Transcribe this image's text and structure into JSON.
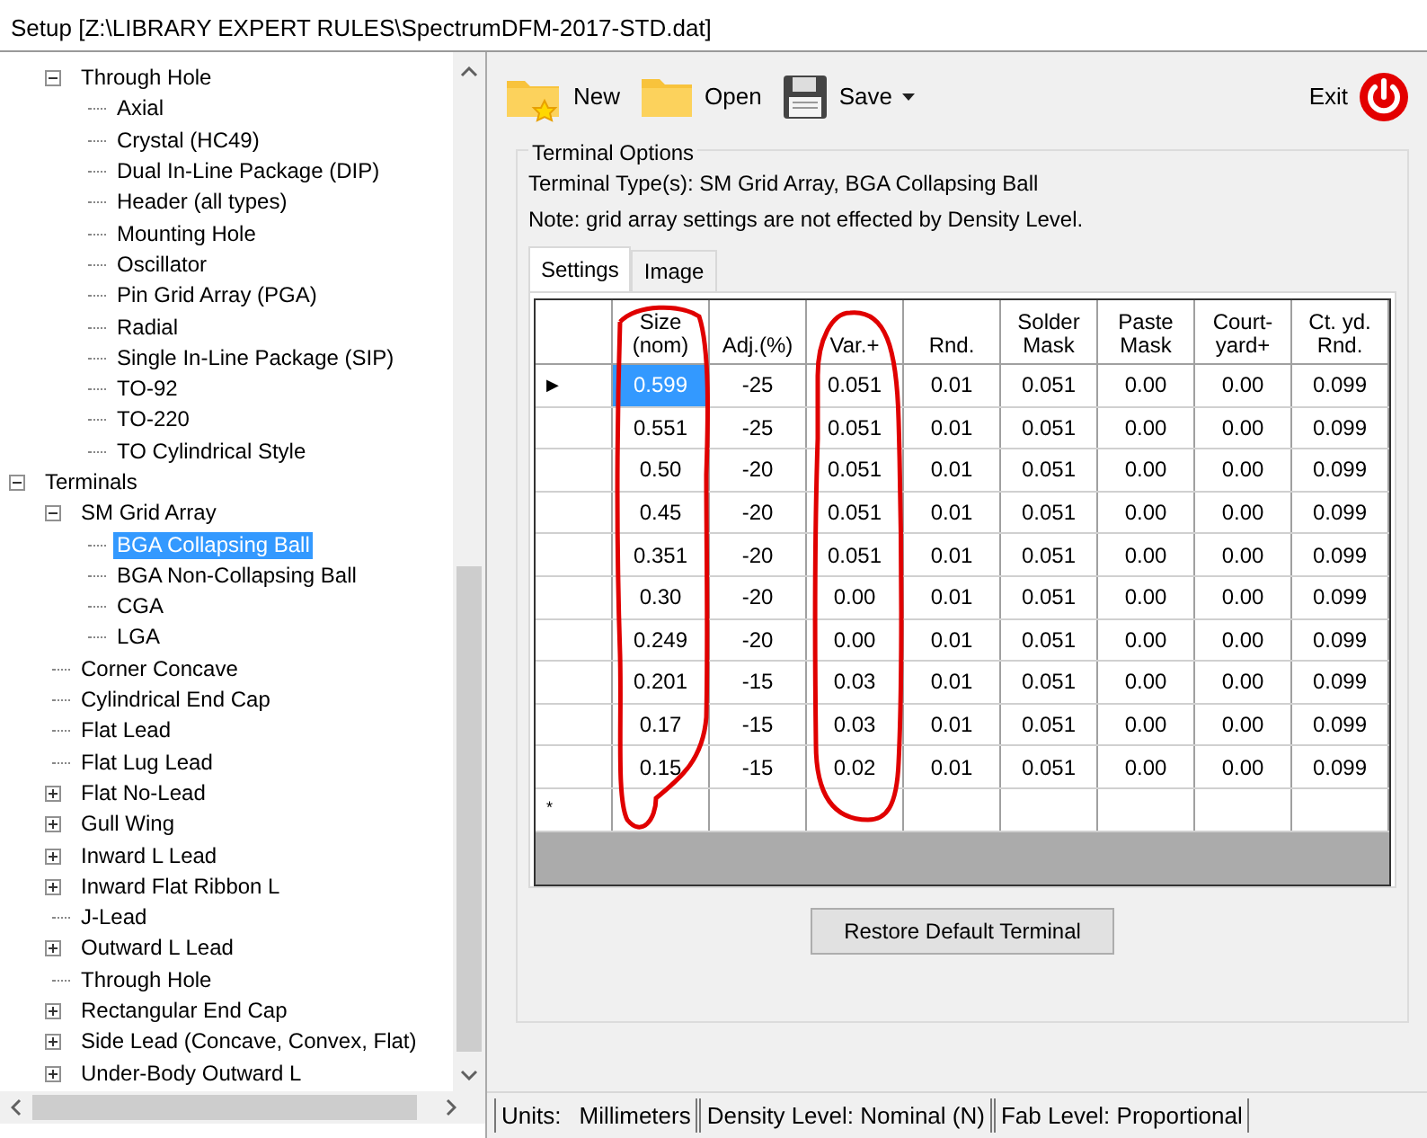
{
  "window": {
    "title": "Setup [Z:\\LIBRARY EXPERT RULES\\SpectrumDFM-2017-STD.dat]"
  },
  "tree": {
    "cut_off_branch": [
      {
        "label": "Through Hole",
        "expanded": true,
        "selected": false,
        "children": [
          {
            "label": "Axial",
            "selected": false
          },
          {
            "label": "Crystal (HC49)",
            "selected": false
          },
          {
            "label": "Dual In-Line Package (DIP)",
            "selected": false
          },
          {
            "label": "Header (all types)",
            "selected": false
          },
          {
            "label": "Mounting Hole",
            "selected": false
          },
          {
            "label": "Oscillator",
            "selected": false
          },
          {
            "label": "Pin Grid Array (PGA)",
            "selected": false
          },
          {
            "label": "Radial",
            "selected": false
          },
          {
            "label": "Single In-Line Package (SIP)",
            "selected": false
          },
          {
            "label": "TO-92",
            "selected": false
          },
          {
            "label": "TO-220",
            "selected": false
          },
          {
            "label": "TO Cylindrical Style",
            "selected": false
          }
        ]
      }
    ],
    "roots": [
      {
        "label": "Terminals",
        "expanded": true,
        "selected": false,
        "children": [
          {
            "label": "SM Grid Array",
            "expanded": true,
            "selected": false,
            "children": [
              {
                "label": "BGA Collapsing Ball",
                "selected": true
              },
              {
                "label": "BGA Non-Collapsing Ball",
                "selected": false
              },
              {
                "label": "CGA",
                "selected": false
              },
              {
                "label": "LGA",
                "selected": false
              }
            ]
          },
          {
            "label": "Corner Concave",
            "selected": false
          },
          {
            "label": "Cylindrical End Cap",
            "selected": false
          },
          {
            "label": "Flat Lead",
            "selected": false
          },
          {
            "label": "Flat Lug Lead",
            "selected": false
          },
          {
            "label": "Flat No-Lead",
            "expanded": false,
            "selected": false
          },
          {
            "label": "Gull Wing",
            "expanded": false,
            "selected": false
          },
          {
            "label": "Inward L Lead",
            "expanded": false,
            "selected": false
          },
          {
            "label": "Inward Flat Ribbon L",
            "expanded": false,
            "selected": false
          },
          {
            "label": "J-Lead",
            "selected": false
          },
          {
            "label": "Outward L Lead",
            "expanded": false,
            "selected": false
          },
          {
            "label": "Through Hole",
            "selected": false
          },
          {
            "label": "Rectangular End Cap",
            "expanded": false,
            "selected": false
          },
          {
            "label": "Side Lead (Concave, Convex, Flat)",
            "expanded": false,
            "selected": false
          },
          {
            "label": "Under-Body Outward L",
            "expanded": false,
            "selected": false
          }
        ]
      }
    ]
  },
  "toolbar": {
    "buttons": [
      {
        "kind": "new",
        "label": "New"
      },
      {
        "kind": "open",
        "label": "Open"
      },
      {
        "kind": "save",
        "label": "Save",
        "dropdown": true
      }
    ],
    "exit": {
      "label": "Exit"
    }
  },
  "terminal_options": {
    "title": "Terminal Options",
    "types": "Terminal Type(s): SM Grid Array, BGA Collapsing Ball",
    "note": "Note: grid array settings are not effected by Density Level.",
    "tabs": [
      {
        "label": "Settings",
        "selected": true
      },
      {
        "label": "Image",
        "selected": false
      }
    ],
    "grid": {
      "columns": [
        "Size\n(nom)",
        "Adj.(%)",
        "Var.+",
        "Rnd.",
        "Solder\nMask",
        "Paste\nMask",
        "Court-\nyard+",
        "Ct. yd.\nRnd."
      ],
      "rows": [
        {
          "marker": "▶",
          "cells": [
            "0.599",
            "-25",
            "0.051",
            "0.01",
            "0.051",
            "0.00",
            "0.00",
            "0.099"
          ],
          "cell_selected": [
            true,
            false,
            false,
            false,
            false,
            false,
            false,
            false
          ]
        },
        {
          "cells": [
            "0.551",
            "-25",
            "0.051",
            "0.01",
            "0.051",
            "0.00",
            "0.00",
            "0.099"
          ],
          "cell_selected": [
            false,
            false,
            false,
            false,
            false,
            false,
            false,
            false
          ]
        },
        {
          "cells": [
            "0.50",
            "-20",
            "0.051",
            "0.01",
            "0.051",
            "0.00",
            "0.00",
            "0.099"
          ],
          "cell_selected": [
            false,
            false,
            false,
            false,
            false,
            false,
            false,
            false
          ]
        },
        {
          "cells": [
            "0.45",
            "-20",
            "0.051",
            "0.01",
            "0.051",
            "0.00",
            "0.00",
            "0.099"
          ],
          "cell_selected": [
            false,
            false,
            false,
            false,
            false,
            false,
            false,
            false
          ]
        },
        {
          "cells": [
            "0.351",
            "-20",
            "0.051",
            "0.01",
            "0.051",
            "0.00",
            "0.00",
            "0.099"
          ],
          "cell_selected": [
            false,
            false,
            false,
            false,
            false,
            false,
            false,
            false
          ]
        },
        {
          "cells": [
            "0.30",
            "-20",
            "0.00",
            "0.01",
            "0.051",
            "0.00",
            "0.00",
            "0.099"
          ],
          "cell_selected": [
            false,
            false,
            false,
            false,
            false,
            false,
            false,
            false
          ]
        },
        {
          "cells": [
            "0.249",
            "-20",
            "0.00",
            "0.01",
            "0.051",
            "0.00",
            "0.00",
            "0.099"
          ],
          "cell_selected": [
            false,
            false,
            false,
            false,
            false,
            false,
            false,
            false
          ]
        },
        {
          "cells": [
            "0.201",
            "-15",
            "0.03",
            "0.01",
            "0.051",
            "0.00",
            "0.00",
            "0.099"
          ],
          "cell_selected": [
            false,
            false,
            false,
            false,
            false,
            false,
            false,
            false
          ]
        },
        {
          "cells": [
            "0.17",
            "-15",
            "0.03",
            "0.01",
            "0.051",
            "0.00",
            "0.00",
            "0.099"
          ],
          "cell_selected": [
            false,
            false,
            false,
            false,
            false,
            false,
            false,
            false
          ]
        },
        {
          "cells": [
            "0.15",
            "-15",
            "0.02",
            "0.01",
            "0.051",
            "0.00",
            "0.00",
            "0.099"
          ],
          "cell_selected": [
            false,
            false,
            false,
            false,
            false,
            false,
            false,
            false
          ]
        }
      ],
      "new_row_marker": "*"
    },
    "restore_button": "Restore Default Terminal"
  },
  "status_bar": {
    "units_label": "Units:",
    "units_value": "Millimeters",
    "density": "Density Level: Nominal (N)",
    "fab_level": "Fab Level: Proportional"
  }
}
